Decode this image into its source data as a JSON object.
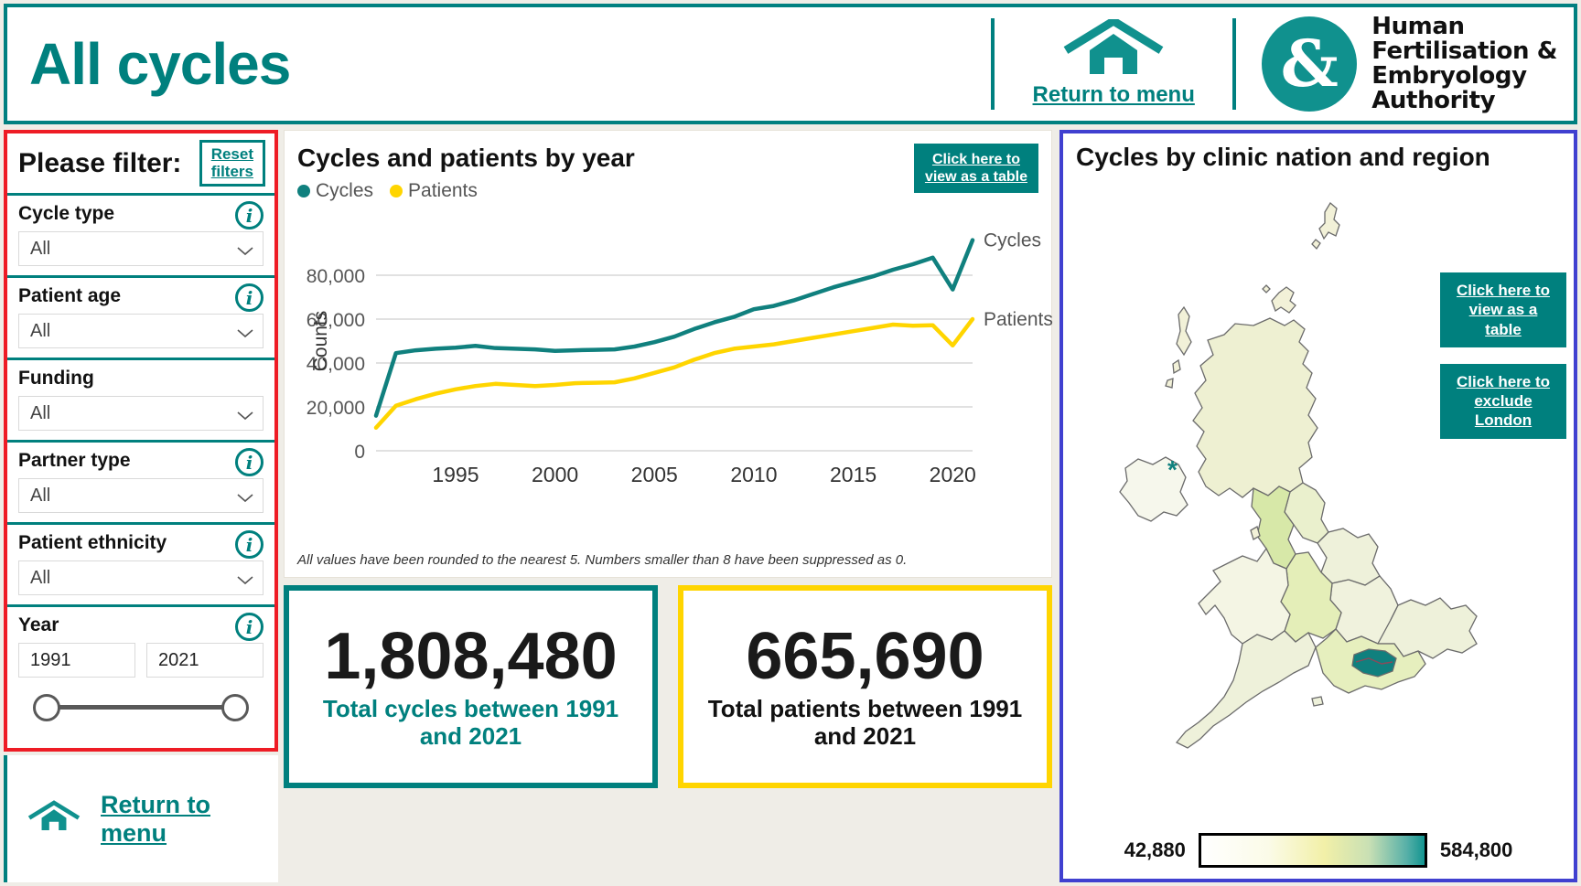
{
  "header": {
    "title": "All cycles",
    "menu_link": "Return to menu",
    "home_icon": "home-icon",
    "logo": {
      "mark": "&",
      "line1": "Human",
      "line2": "Fertilisation &",
      "line3": "Embryology",
      "line4": "Authority"
    }
  },
  "sidebar": {
    "title": "Please filter:",
    "reset_line1": "Reset",
    "reset_line2": "filters",
    "filters": [
      {
        "label": "Cycle type",
        "value": "All",
        "has_info": true
      },
      {
        "label": "Patient age",
        "value": "All",
        "has_info": true
      },
      {
        "label": "Funding",
        "value": "All",
        "has_info": false
      },
      {
        "label": "Partner type",
        "value": "All",
        "has_info": true
      },
      {
        "label": "Patient ethnicity",
        "value": "All",
        "has_info": true
      }
    ],
    "year": {
      "label": "Year",
      "from": "1991",
      "to": "2021"
    },
    "footer_link": "Return to menu"
  },
  "chart_panel": {
    "title": "Cycles and patients by year",
    "table_btn_line1": "Click here to",
    "table_btn_line2": "view as a table",
    "footnote": "All values have been rounded to the nearest 5. Numbers smaller than 8 have been suppressed as 0.",
    "series_end_label_cycles": "Cycles",
    "series_end_label_patients": "Patients"
  },
  "chart_data": {
    "type": "line",
    "title": "Cycles and patients by year",
    "xlabel": "",
    "ylabel": "Counts",
    "ylim": [
      0,
      100000
    ],
    "yticks": [
      0,
      20000,
      40000,
      60000,
      80000
    ],
    "ytick_labels": [
      "0",
      "20,000",
      "40,000",
      "60,000",
      "80,000"
    ],
    "xlim": [
      1991,
      2021
    ],
    "xticks": [
      1995,
      2000,
      2005,
      2010,
      2015,
      2020
    ],
    "xtick_labels": [
      "1995",
      "2000",
      "2005",
      "2010",
      "2015",
      "2020"
    ],
    "grid": "horizontal",
    "legend_position": "top-left",
    "x": [
      1991,
      1992,
      1993,
      1994,
      1995,
      1996,
      1997,
      1998,
      1999,
      2000,
      2001,
      2002,
      2003,
      2004,
      2005,
      2006,
      2007,
      2008,
      2009,
      2010,
      2011,
      2012,
      2013,
      2014,
      2015,
      2016,
      2017,
      2018,
      2019,
      2020,
      2021
    ],
    "series": [
      {
        "name": "Cycles",
        "color": "#10807e",
        "values": [
          16000,
          44500,
          45800,
          46500,
          47000,
          47800,
          46800,
          46500,
          46200,
          45500,
          45800,
          46000,
          46200,
          47500,
          49500,
          52000,
          55500,
          58500,
          61000,
          64500,
          66000,
          68500,
          71500,
          74500,
          77000,
          79500,
          82500,
          85000,
          88000,
          73500,
          96000
        ]
      },
      {
        "name": "Patients",
        "color": "#ffd500",
        "values": [
          10500,
          20500,
          23500,
          26000,
          28000,
          29500,
          30500,
          30000,
          29500,
          30000,
          30800,
          31000,
          31200,
          33000,
          35500,
          38000,
          41500,
          44500,
          46500,
          47500,
          48500,
          50000,
          51500,
          53000,
          54500,
          56000,
          57500,
          57000,
          57200,
          48000,
          60000
        ]
      }
    ]
  },
  "kpis": [
    {
      "value": "1,808,480",
      "label": "Total cycles between 1991 and 2021",
      "accent": "#00807e"
    },
    {
      "value": "665,690",
      "label": "Total patients between 1991 and 2021",
      "accent": "#ffd500"
    }
  ],
  "map_panel": {
    "title": "Cycles by clinic nation and region",
    "btn1_line1": "Click here to",
    "btn1_line2": "view as a table",
    "btn2_line1": "Click here to",
    "btn2_line2": "exclude London",
    "legend_min": "42,880",
    "legend_max": "584,800"
  },
  "colors": {
    "teal": "#00807e",
    "yellow": "#ffd500",
    "red_border": "#ee1c25",
    "blue_border": "#4040d0",
    "page_bg": "#efede7"
  }
}
